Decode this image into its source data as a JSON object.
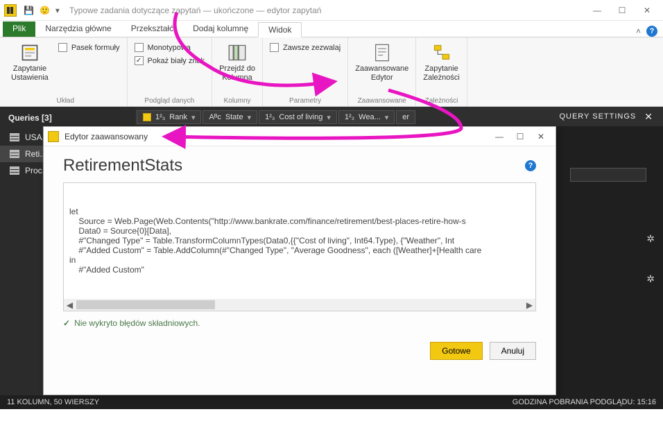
{
  "title": "Typowe zadania dotyczące zapytań — ukończone — edytor zapytań",
  "tabs": {
    "file": "Plik",
    "home": "Narzędzia główne",
    "transform": "Przekształć",
    "addcol": "Dodaj kolumnę",
    "view": "Widok"
  },
  "ribbon": {
    "layout": "Układ",
    "querySettings1": "Zapytanie",
    "querySettings2": "Ustawienia",
    "formulaBar": "Pasek formuły",
    "dataPreview": "Podgląd danych",
    "monospace": "Monotypowa",
    "whitespace": "Pokaż biały znak",
    "columns": "Kolumny",
    "gotoCol1": "Przejdź do",
    "gotoCol2": "Kolumna",
    "params": "Parametry",
    "alwaysAllow": "Zawsze zezwalaj",
    "advanced": "Zaawansowane",
    "advEditor1": "Zaawansowane",
    "advEditor2": "Edytor",
    "deps": "Zależności",
    "queryDeps1": "Zapytanie",
    "queryDeps2": "Zależności"
  },
  "queriesTitle": "Queries [3]",
  "queryItems": [
    "USA...",
    "Reti...",
    "Proc..."
  ],
  "columnsStrip": [
    "Rank",
    "State",
    "Cost of living",
    "Wea...",
    "er"
  ],
  "settingsTitle": "QUERY SETTINGS",
  "statusLeft": "11 KOLUMN, 50 WIERSZY",
  "statusRight": "GODZINA POBRANIA PODGLĄDU: 15:16",
  "dialog": {
    "title": "Edytor zaawansowany",
    "heading": "RetirementStats",
    "code": "let\n    Source = Web.Page(Web.Contents(\"http://www.bankrate.com/finance/retirement/best-places-retire-how-s\n    Data0 = Source{0}[Data],\n    #\"Changed Type\" = Table.TransformColumnTypes(Data0,{{\"Cost of living\", Int64.Type}, {\"Weather\", Int\n    #\"Added Custom\" = Table.AddColumn(#\"Changed Type\", \"Average Goodness\", each ([Weather]+[Health care\nin\n    #\"Added Custom\"",
    "syntaxOk": "Nie wykryto błędów składniowych.",
    "done": "Gotowe",
    "cancel": "Anuluj"
  }
}
